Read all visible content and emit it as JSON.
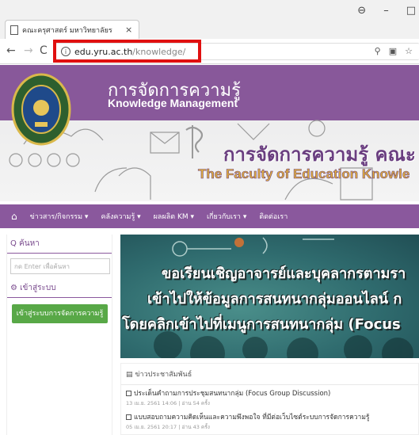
{
  "browser": {
    "tab_title": "คณะครุศาสตร์ มหาวิทยาลัยร",
    "tab_close": "×",
    "url_host": "edu.yru.ac.th",
    "url_path": "/knowledge/",
    "win_profile": "⊖",
    "win_minimize": "–",
    "win_maximize": "□",
    "nav_back": "←",
    "nav_forward": "→",
    "nav_reload": "C"
  },
  "header": {
    "title_th": "การจัดการความรู้",
    "title_en": "Knowledge Management",
    "banner_th": "การจัดการความรู้ คณะ",
    "banner_en": "The Faculty of Education  Knowle"
  },
  "nav": {
    "items": [
      "ข่าวสาร/กิจกรรม ▾",
      "คลังความรู้ ▾",
      "ผลผลิต KM ▾",
      "เกี่ยวกับเรา ▾",
      "ติดต่อเรา"
    ]
  },
  "sidebar": {
    "search_heading": "Q ค้นหา",
    "search_placeholder": "กด Enter เพื่อค้นหา",
    "login_heading": "⚙ เข้าสู่ระบบ",
    "login_button": "เข้าสู่ระบบการจัดการความรู้"
  },
  "banner": {
    "line1": "ขอเรียนเชิญอาจารย์และบุคลากรตามรา",
    "line2": "เข้าไปให้ข้อมูลการสนทนากลุ่มออนไลน์ ก",
    "line3": "โดยคลิกเข้าไปที่เมนูการสนทนากลุ่ม (Focus"
  },
  "news": {
    "heading": "ข่าวประชาสัมพันธ์",
    "items": [
      {
        "title": "ประเด็นคำถามการประชุมสนทนากลุ่ม (Focus Group Discussion)",
        "meta": "13 เม.ย. 2561 14:06 | อ่าน 54 ครั้ง"
      },
      {
        "title": "แบบสอบถามความคิดเห็นและความพึงพอใจ ที่มีต่อเว็บไซต์ระบบการจัดการความรู้",
        "meta": "05 เม.ย. 2561 20:17 | อ่าน 43 ครั้ง"
      }
    ]
  }
}
